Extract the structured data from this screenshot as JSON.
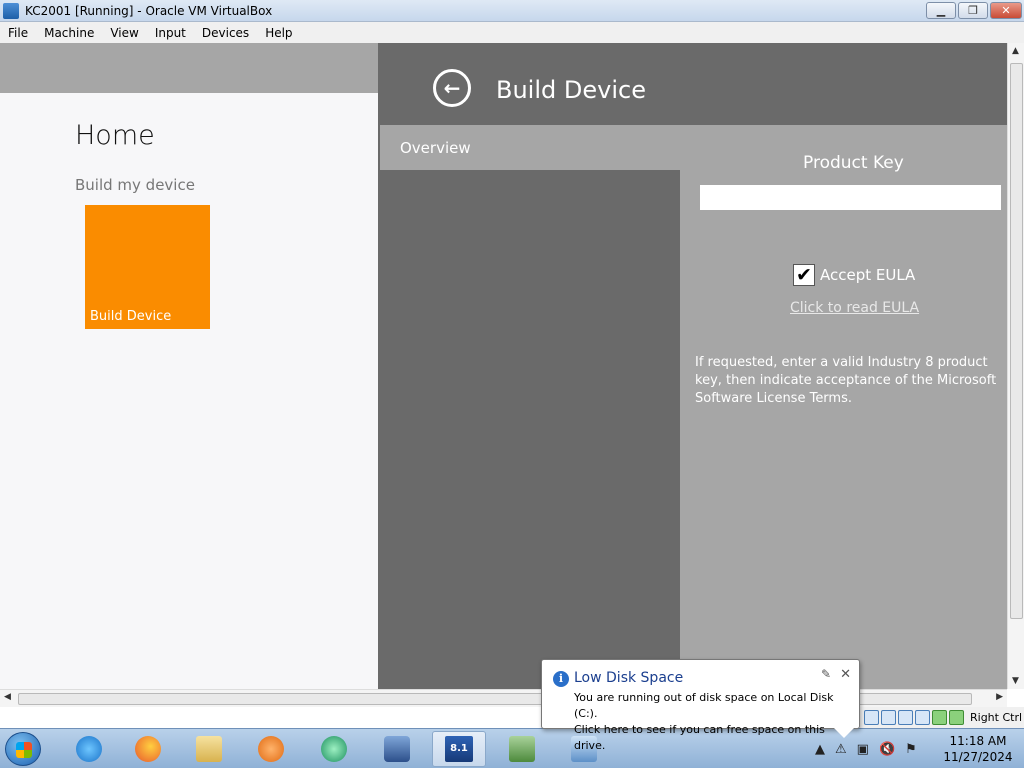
{
  "window": {
    "title": "KC2001 [Running] - Oracle VM VirtualBox",
    "minimize": "▁",
    "restore": "❐",
    "close": "✕"
  },
  "menu": [
    "File",
    "Machine",
    "View",
    "Input",
    "Devices",
    "Help"
  ],
  "home": {
    "title": "Home",
    "section": "Build my device",
    "tile_label": "Build Device",
    "tile_color": "#fa8c00"
  },
  "panel": {
    "back_icon": "←",
    "title": "Build Device",
    "tab": "Overview",
    "product_key_label": "Product Key",
    "product_key_value": "",
    "accept_eula": "Accept EULA",
    "accept_eula_checked": "✔",
    "eula_link": "Click to read EULA",
    "help_text": "If requested, enter a valid Industry 8 product key, then indicate acceptance of the Microsoft Software License Terms."
  },
  "statusbar": {
    "host_key": "Right Ctrl"
  },
  "balloon": {
    "title": "Low Disk Space",
    "line1": "You are running out of disk space on Local Disk (C:).",
    "line2": "Click here to see if you can free space on this drive.",
    "close": "✕",
    "options": "✎"
  },
  "clock": {
    "time": "11:18 AM",
    "date": "11/27/2024"
  },
  "taskbar_badge": "8.1",
  "colors": {
    "panel_dark": "#6a6a6a",
    "panel_light": "#a6a6a6",
    "accent_orange": "#fa8c00"
  }
}
